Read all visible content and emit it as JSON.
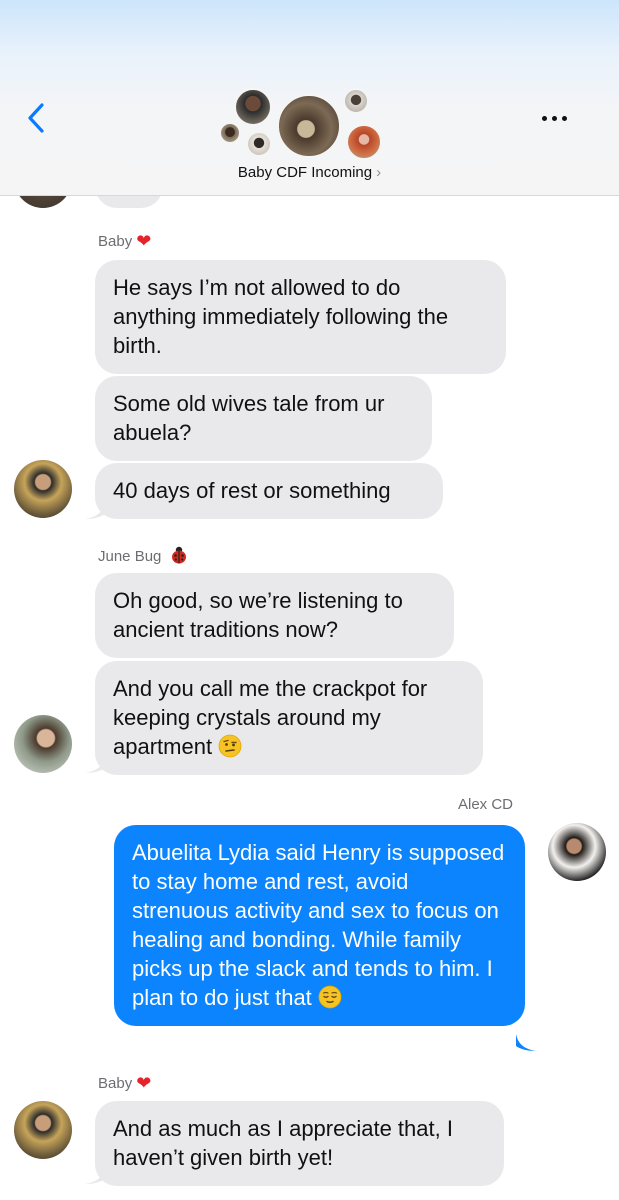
{
  "header": {
    "group_name": "Baby CDF Incoming",
    "chevron": "›",
    "back_icon": "chevron-left-icon",
    "more_icon": "ellipsis-icon"
  },
  "senders": {
    "baby": "Baby",
    "june": "June Bug",
    "alex": "Alex CD"
  },
  "messages": [
    {
      "from": "baby",
      "text": "He says I’m not allowed to do anything immediately following the birth."
    },
    {
      "from": "baby",
      "text": "Some old wives tale from ur abuela?"
    },
    {
      "from": "baby",
      "text": "40 days of rest or something"
    },
    {
      "from": "june",
      "text": "Oh good, so we’re listening to ancient traditions now?"
    },
    {
      "from": "june",
      "text": "And you call me the crackpot for keeping crystals around my apartment",
      "emoji": "face-with-raised-eyebrow"
    },
    {
      "from": "alex",
      "text": "Abuelita Lydia said Henry is supposed to stay home and rest, avoid strenuous activity and sex to focus on healing and bonding. While family picks up the slack and tends to him. I plan to do just that",
      "emoji": "relieved-face"
    },
    {
      "from": "baby",
      "text": "And as much as I appreciate that, I haven’t given birth yet!"
    }
  ],
  "colors": {
    "incoming_bubble": "#e9e9eb",
    "outgoing_bubble": "#0b84fe",
    "ios_blue": "#0a7aff",
    "heart": "#e3242b"
  }
}
